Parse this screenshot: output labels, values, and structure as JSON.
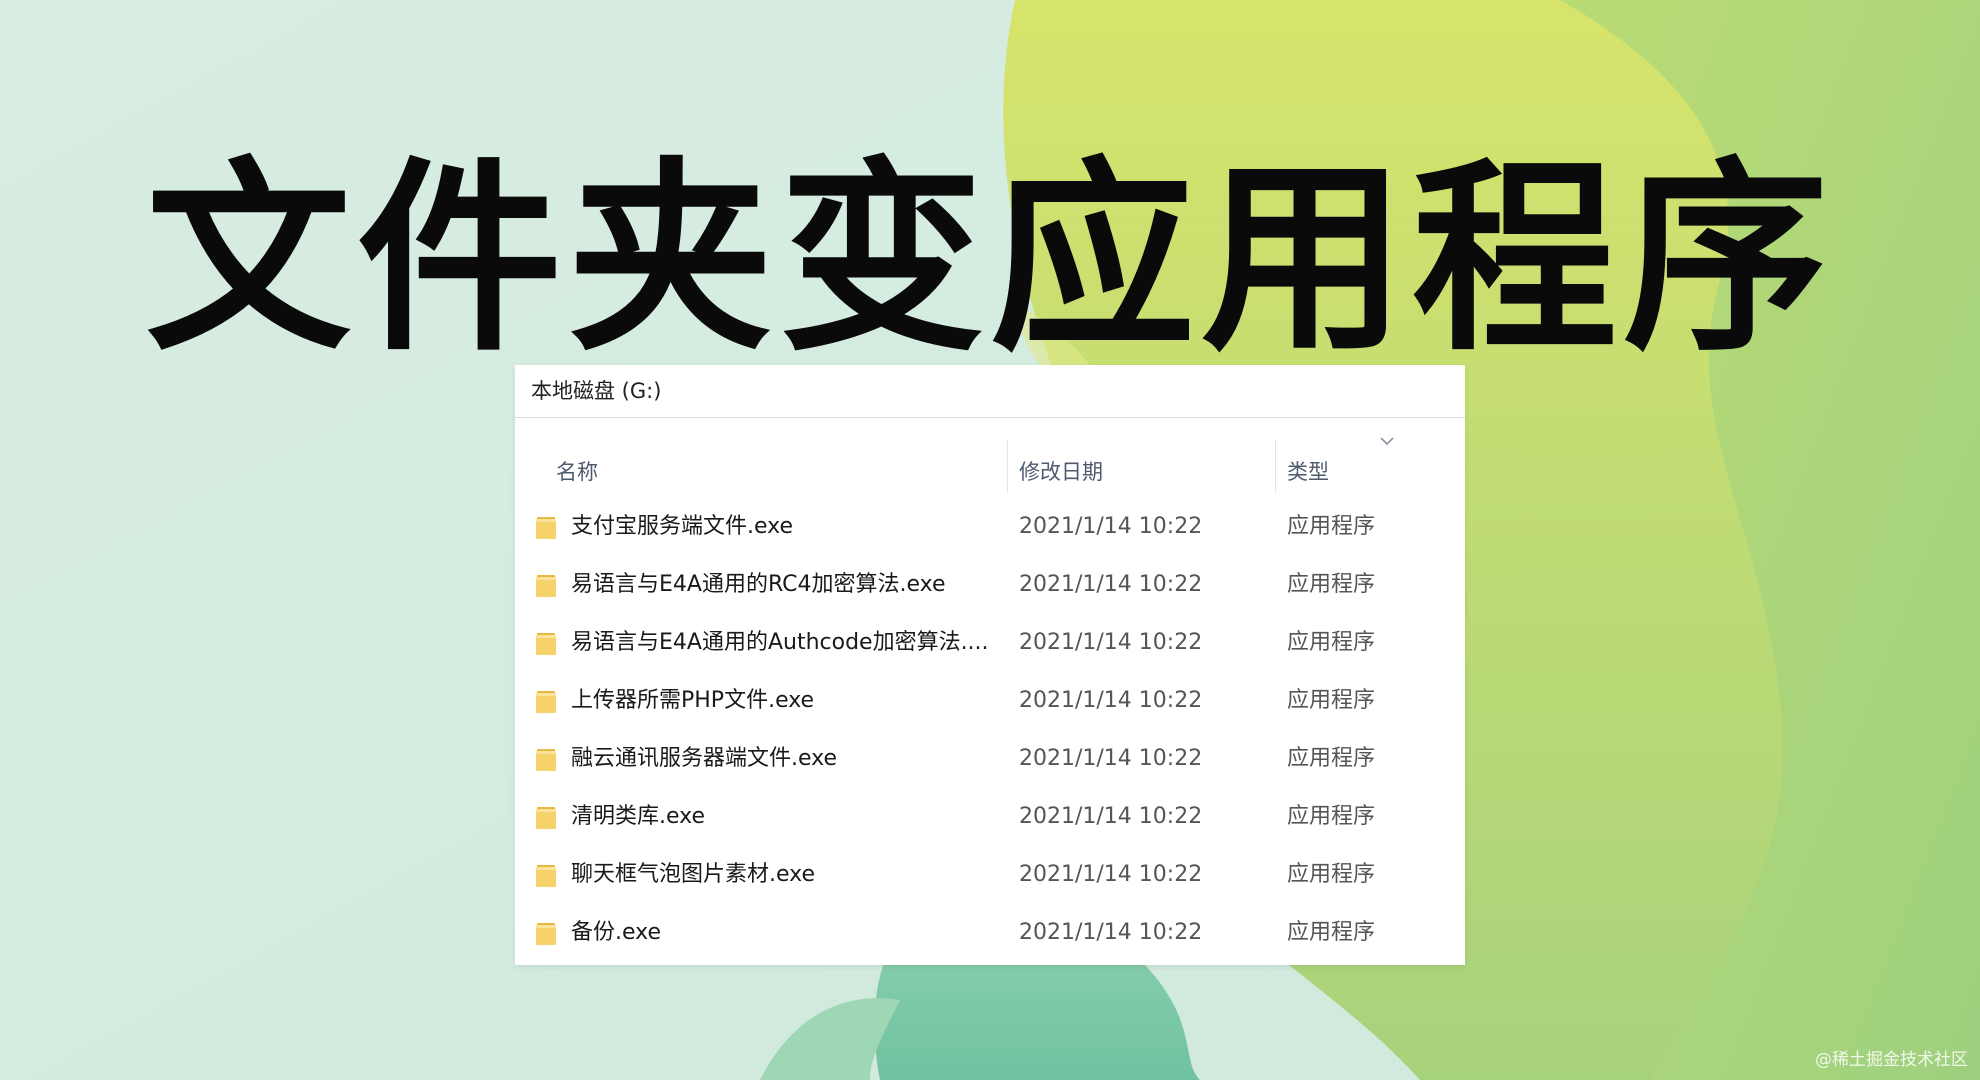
{
  "headline": "文件夹变应用程序",
  "explorer": {
    "address": "本地磁盘 (G:)",
    "columns": {
      "name": "名称",
      "date": "修改日期",
      "type": "类型"
    },
    "rows": [
      {
        "name": "支付宝服务端文件.exe",
        "date": "2021/1/14 10:22",
        "type": "应用程序"
      },
      {
        "name": "易语言与E4A通用的RC4加密算法.exe",
        "date": "2021/1/14 10:22",
        "type": "应用程序"
      },
      {
        "name": "易语言与E4A通用的Authcode加密算法....",
        "date": "2021/1/14 10:22",
        "type": "应用程序"
      },
      {
        "name": "上传器所需PHP文件.exe",
        "date": "2021/1/14 10:22",
        "type": "应用程序"
      },
      {
        "name": "融云通讯服务器端文件.exe",
        "date": "2021/1/14 10:22",
        "type": "应用程序"
      },
      {
        "name": "清明类库.exe",
        "date": "2021/1/14 10:22",
        "type": "应用程序"
      },
      {
        "name": "聊天框气泡图片素材.exe",
        "date": "2021/1/14 10:22",
        "type": "应用程序"
      },
      {
        "name": "备份.exe",
        "date": "2021/1/14 10:22",
        "type": "应用程序"
      }
    ]
  },
  "watermark": "@稀土掘金技术社区",
  "icons": {
    "row": "folder-icon",
    "sort": "chevron-down-icon"
  },
  "colors": {
    "folder": "#f6d26b",
    "bg_mint": "#cfe9da",
    "bg_lime": "#cfe26d",
    "bg_teal": "#7cc9a6"
  }
}
